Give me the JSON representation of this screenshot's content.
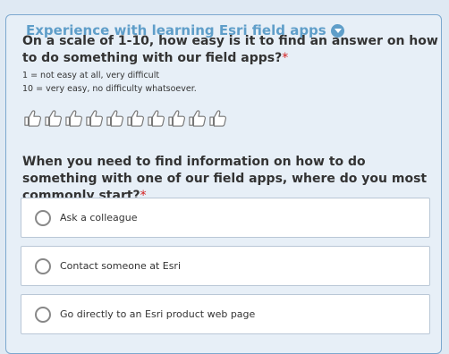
{
  "section": {
    "title": "Experience with learning Esri field apps",
    "collapse_icon": "chevron-down-circle-icon",
    "accent_color": "#5f9ec9"
  },
  "question1": {
    "text": "On a scale of 1-10, how easy is it to find an answer on how to do something with our field apps?",
    "required_mark": "*",
    "description_line1": "1 = not easy at all, very difficult",
    "description_line2": "10 = very easy, no difficulty whatsoever.",
    "rating_icon": "thumbs-up-icon",
    "rating_max": 10,
    "rating_value": 0
  },
  "question2": {
    "text": "When you need to find information on how to do something with one of our field apps, where do you most commonly start?",
    "required_mark": "*",
    "options": [
      {
        "label": "Ask a colleague"
      },
      {
        "label": "Contact someone at Esri"
      },
      {
        "label": "Go directly to an Esri product web page"
      }
    ]
  }
}
